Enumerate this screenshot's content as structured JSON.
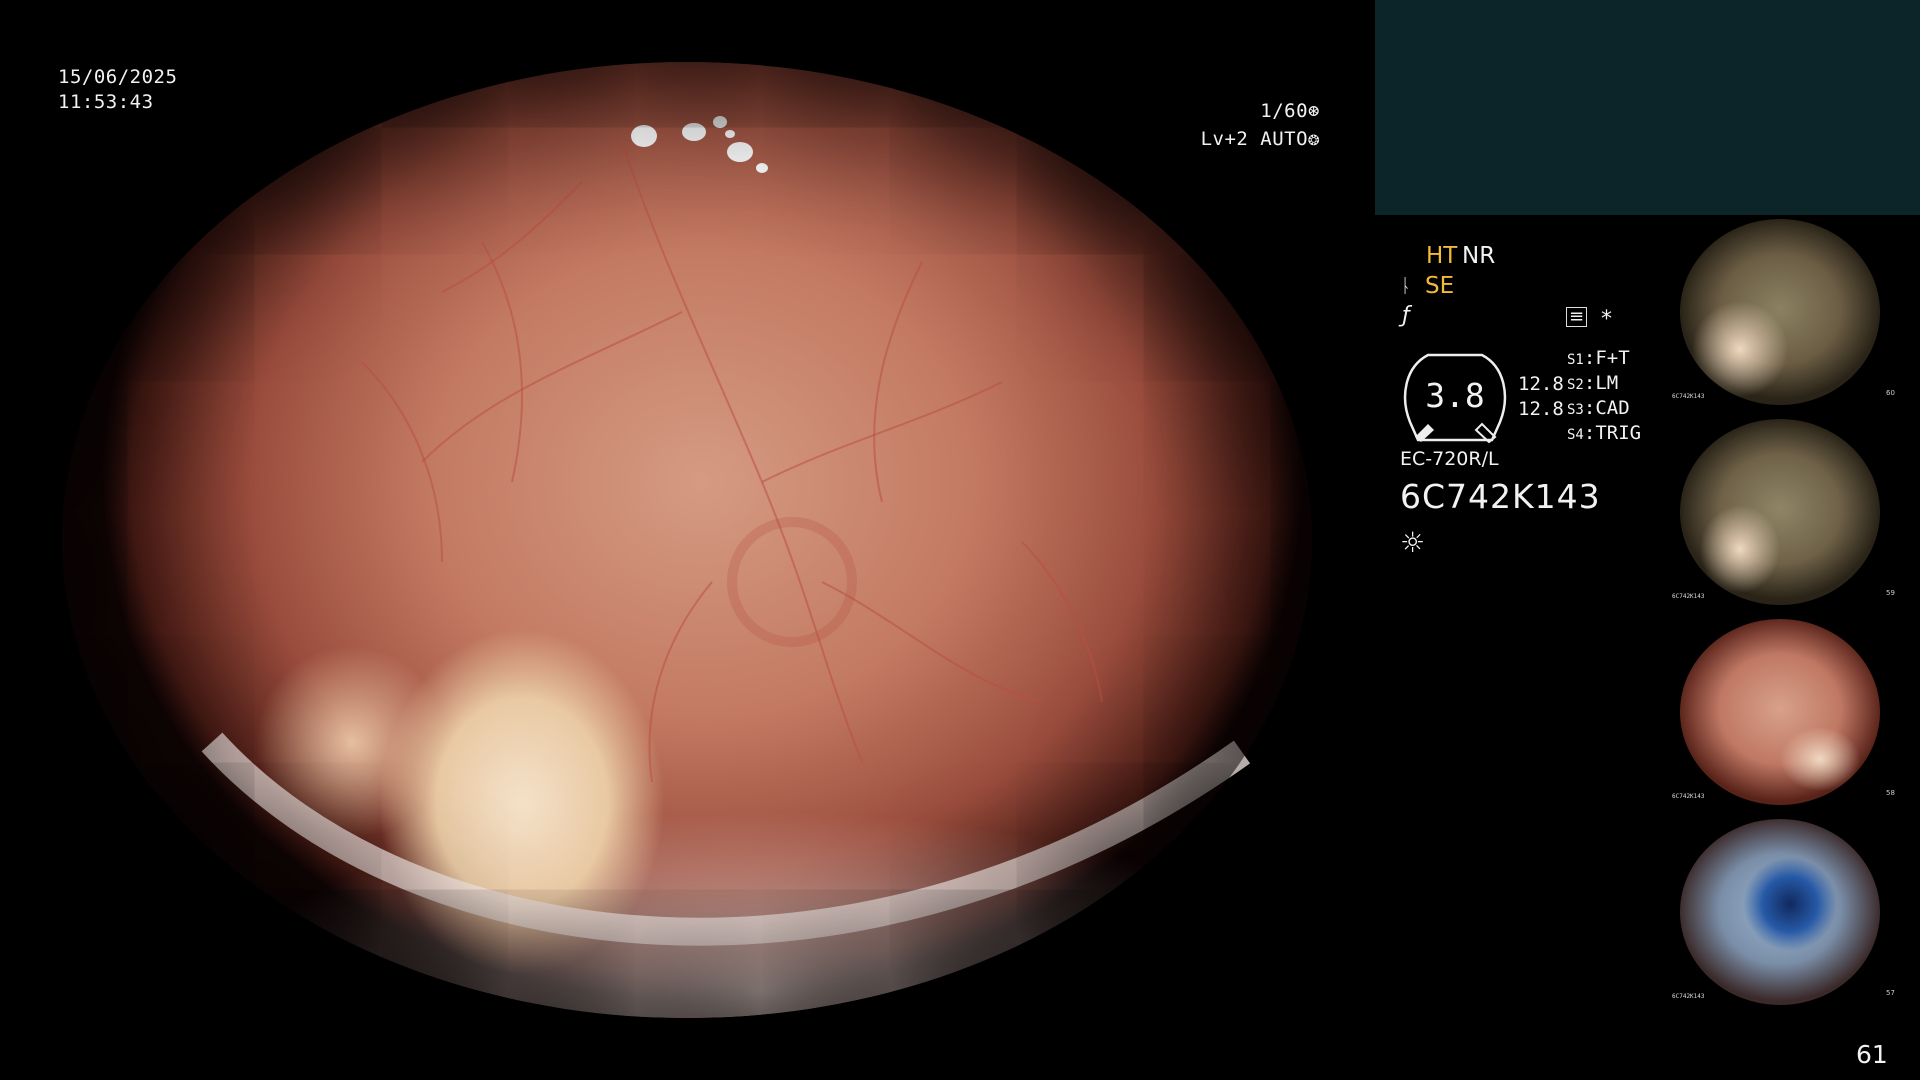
{
  "overlay": {
    "date": "15/06/2025",
    "time": "11:53:43",
    "shutter": "1/60",
    "shutter_icon": "aperture-icon",
    "level": "Lv+2 AUTO",
    "level_icon": "iris-icon"
  },
  "panel": {
    "ht": "HT",
    "nr": "NR",
    "se": "SE",
    "gauge_value": "3.8",
    "gauge_scale_top": "12.8",
    "gauge_scale_bottom": "12.8",
    "scope_model": "EC-720R/L",
    "serial": "6C742K143",
    "switches": [
      {
        "key": "S1",
        "value": "F+T"
      },
      {
        "key": "S2",
        "value": "LM"
      },
      {
        "key": "S3",
        "value": "CAD"
      },
      {
        "key": "S4",
        "value": "TRIG"
      }
    ],
    "icons": [
      "contrast-icon",
      "function-icon",
      "histogram-icon",
      "asterisk-icon",
      "sun-icon"
    ]
  },
  "thumbnails": [
    {
      "number": "60",
      "serial": "6C742K143"
    },
    {
      "number": "59",
      "serial": "6C742K143"
    },
    {
      "number": "58",
      "serial": "6C742K143"
    },
    {
      "number": "57",
      "serial": "6C742K143"
    }
  ],
  "page_number": "61"
}
